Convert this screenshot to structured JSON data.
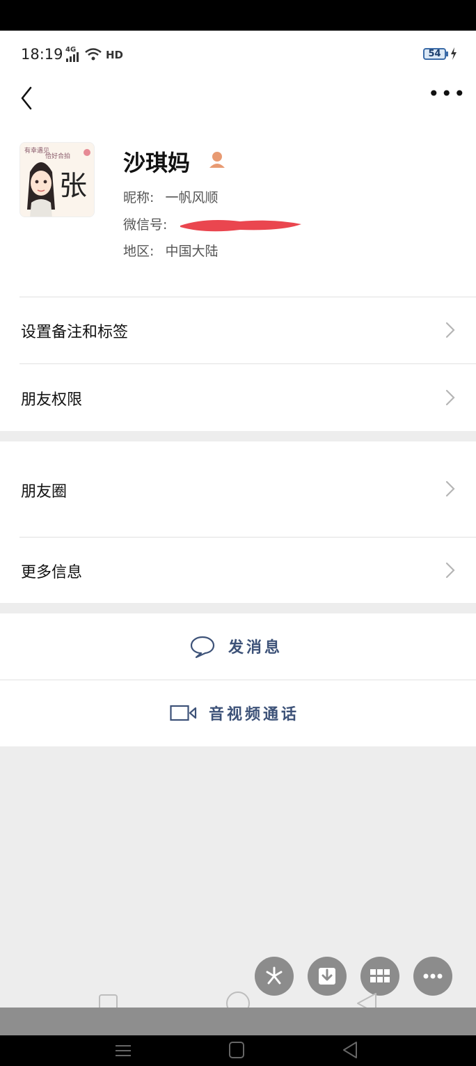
{
  "status_bar": {
    "time": "18:19",
    "network": "4G",
    "hd": "HD",
    "battery": "54"
  },
  "header": {
    "back_icon": "chevron-left-icon",
    "more_icon": "more-horizontal-icon",
    "more_label": "•••"
  },
  "profile": {
    "avatar_badge": "有幸遇见 恰好合拍",
    "avatar_letter": "张",
    "name": "沙琪妈",
    "nickname_label": "昵称:",
    "nickname_value": "一帆风顺",
    "wechat_id_label": "微信号:",
    "region_label": "地区:",
    "region_value": "中国大陆"
  },
  "menu": {
    "set_remark": "设置备注和标签",
    "friend_permissions": "朋友权限",
    "moments": "朋友圈",
    "more_info": "更多信息"
  },
  "actions": {
    "send_message": "发消息",
    "video_call": "音视频通话"
  },
  "floating_buttons": [
    "pinwheel-icon",
    "download-icon",
    "grid-icon",
    "more-icon"
  ],
  "colors": {
    "action_text": "#3d5278",
    "background": "#ededed",
    "redaction": "#e8323c"
  }
}
